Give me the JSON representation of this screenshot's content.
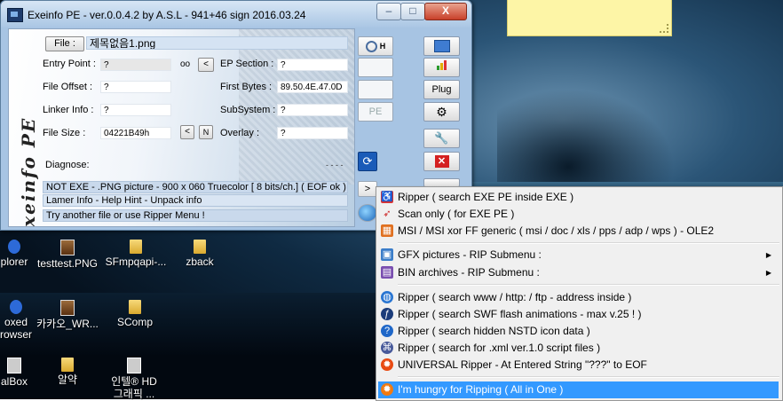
{
  "window": {
    "title": "Exeinfo PE - ver.0.0.4.2   by A.S.L -   941+46 sign  2016.03.24",
    "min": "–",
    "max": "□",
    "close": "X"
  },
  "logo_text": "Exeinfo PE",
  "file": {
    "button": "File :",
    "name": "제목없음1.png"
  },
  "fields": {
    "entry_point_label": "Entry Point :",
    "entry_point": "?",
    "oo": "oo",
    "ep_lt": "<",
    "ep_section_label": "EP Section :",
    "ep_section": "?",
    "file_offset_label": "File Offset :",
    "file_offset": "?",
    "first_bytes_label": "First Bytes :",
    "first_bytes": "89.50.4E.47.0D",
    "linker_info_label": "Linker Info :",
    "linker_info": "?",
    "subsystem_label": "SubSystem :",
    "subsystem": "?",
    "file_size_label": "File Size :",
    "file_size": "04221B49h",
    "fs_lt": "<",
    "fs_n": "N",
    "overlay_label": "Overlay :",
    "overlay": "?",
    "diagnose_label": "Diagnose:",
    "diagnose_dots": "- - - -"
  },
  "status": {
    "line1": "NOT EXE - .PNG picture  - 900 x 060 Truecolor [ 8 bits/ch.]  ( EOF ok )",
    "line2": "Lamer Info - Help Hint - Unpack info",
    "line3": "Try another file or use Ripper Menu !",
    "arrow_btn": ">"
  },
  "side_buttons": {
    "search_h": "H",
    "pe": "PE",
    "plug": "Plug"
  },
  "menu": [
    {
      "label": "Ripper ( search EXE PE inside EXE )",
      "icon": "ripper-exe-icon",
      "color": "#d33"
    },
    {
      "label": "Scan only ( for EXE PE )",
      "icon": "arrow-icon",
      "color": "#c22"
    },
    {
      "label": "MSI / MSI xor FF generic ( msi / doc / xls / pps / adp / wps )  - OLE2",
      "icon": "msi-icon",
      "color": "#e07020"
    },
    {
      "label": "GFX pictures      -   RIP Submenu :",
      "icon": "picture-icon",
      "color": "#3b7dc9",
      "submenu": true
    },
    {
      "label": "BIN archives      -   RIP Submenu :",
      "icon": "archive-icon",
      "color": "#7a4fb0",
      "submenu": true
    },
    {
      "label": "Ripper ( search www / http: / ftp  - address inside  )",
      "icon": "globe-icon",
      "color": "#2a76d2"
    },
    {
      "label": "Ripper ( search SWF flash animations - max v.25 ! )",
      "icon": "flash-icon",
      "color": "#1b3c7a"
    },
    {
      "label": "Ripper ( search hidden NSTD icon data )",
      "icon": "help-icon",
      "color": "#1f67c8"
    },
    {
      "label": "Ripper ( search for .xml ver.1.0 script files )",
      "icon": "xml-icon",
      "color": "#485a9a"
    },
    {
      "label": "UNIVERSAL Ripper  - At Entered String \"???\" to EOF",
      "icon": "fire-icon",
      "color": "#e84a12"
    },
    {
      "label": "I'm hungry for Ripping ( All in One )",
      "icon": "hungry-icon",
      "color": "#f07a12"
    }
  ],
  "desktop_icons": [
    {
      "label": "plorer",
      "type": "ie"
    },
    {
      "label": "testtest.PNG",
      "type": "png"
    },
    {
      "label": "SFmpqapi-...",
      "type": "folder"
    },
    {
      "label": "zback",
      "type": "folder"
    },
    {
      "label": "oxed",
      "type": "ie"
    },
    {
      "label": "rowser",
      "type": "none"
    },
    {
      "label": "카카오_WR...",
      "type": "png"
    },
    {
      "label": "SComp",
      "type": "folder"
    },
    {
      "label": "alBox",
      "type": "hd"
    },
    {
      "label": "알약",
      "type": "folder"
    },
    {
      "label": "인텔® HD",
      "type": "hd"
    },
    {
      "label": "그래픽 ...",
      "type": "none"
    }
  ]
}
